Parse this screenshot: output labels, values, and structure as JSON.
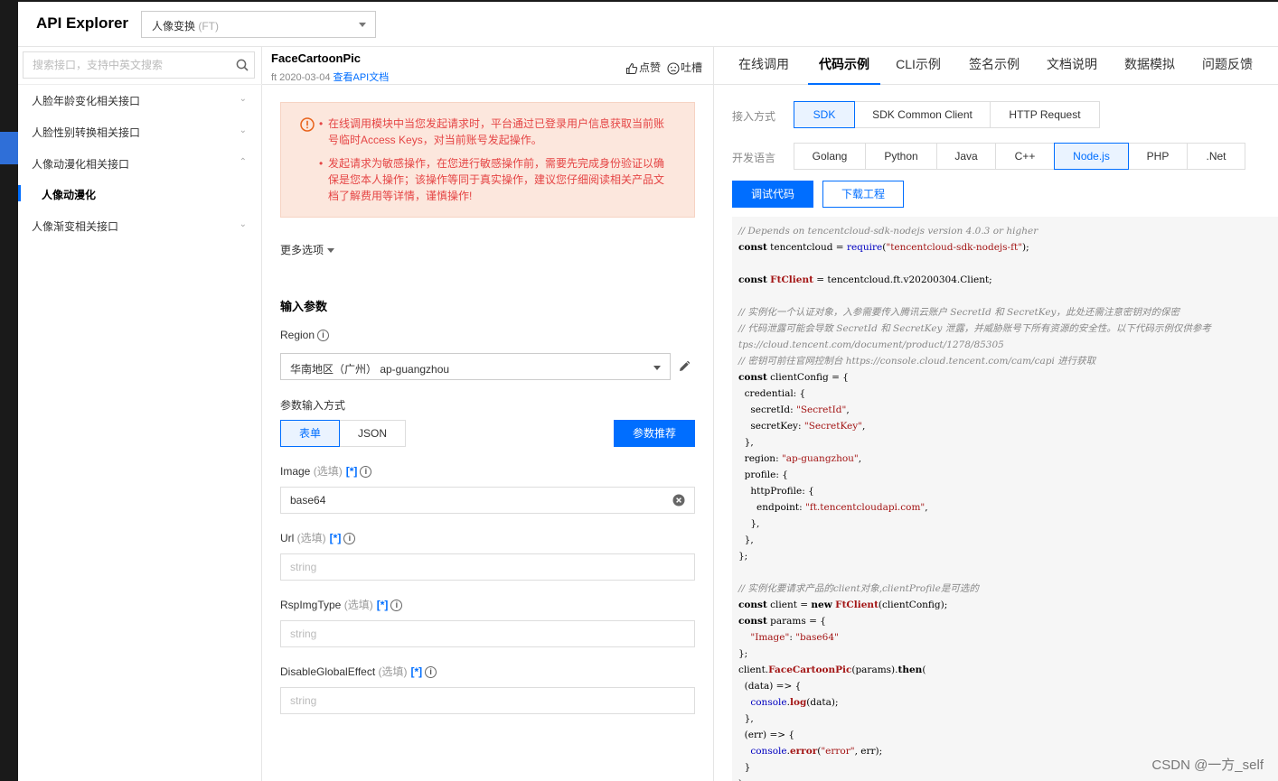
{
  "header": {
    "app_title": "API Explorer",
    "product": {
      "name": "人像变换",
      "code": "(FT)"
    }
  },
  "sidebar": {
    "search_placeholder": "搜索接口，支持中英文搜索",
    "items": [
      {
        "label": "人脸年龄变化相关接口",
        "chevron": "⌄"
      },
      {
        "label": "人脸性别转换相关接口",
        "chevron": "⌄"
      },
      {
        "label": "人像动漫化相关接口",
        "chevron": "⌃"
      },
      {
        "label": "人像动漫化"
      },
      {
        "label": "人像渐变相关接口",
        "chevron": "⌄"
      }
    ]
  },
  "api": {
    "name": "FaceCartoonPic",
    "meta": "ft 2020-03-04",
    "doc_link": "查看API文档",
    "like": "点赞",
    "comment": "吐槽"
  },
  "warning": {
    "line1": "在线调用模块中当您发起请求时，平台通过已登录用户信息获取当前账号临时Access Keys，对当前账号发起操作。",
    "line2": "发起请求为敏感操作，在您进行敏感操作前，需要先完成身份验证以确保是您本人操作；该操作等同于真实操作，建议您仔细阅读相关产品文档了解费用等详情，谨慎操作!"
  },
  "form": {
    "more_options": "更多选项",
    "input_params_title": "输入参数",
    "region_label": "Region",
    "region_value": "华南地区（广州） ap-guangzhou",
    "mode_label": "参数输入方式",
    "mode_table": "表单",
    "mode_json": "JSON",
    "param_recommend": "参数推荐",
    "optional": "(选填)",
    "bracket": "[*]",
    "fields": [
      {
        "name": "Image",
        "value": "base64",
        "placeholder": ""
      },
      {
        "name": "Url",
        "value": "",
        "placeholder": "string"
      },
      {
        "name": "RspImgType",
        "value": "",
        "placeholder": "string"
      },
      {
        "name": "DisableGlobalEffect",
        "value": "",
        "placeholder": "string"
      }
    ]
  },
  "right": {
    "tabs": [
      "在线调用",
      "代码示例",
      "CLI示例",
      "签名示例",
      "文档说明",
      "数据模拟",
      "问题反馈"
    ],
    "active_tab": "代码示例",
    "access_label": "接入方式",
    "access_options": [
      "SDK",
      "SDK Common Client",
      "HTTP Request"
    ],
    "access_active": "SDK",
    "lang_label": "开发语言",
    "languages": [
      "Golang",
      "Python",
      "Java",
      "C++",
      "Node.js",
      "PHP",
      ".Net"
    ],
    "lang_active": "Node.js",
    "debug_button": "调试代码",
    "download_button": "下载工程"
  },
  "code": {
    "l1": "// Depends on tencentcloud-sdk-nodejs version 4.0.3 or higher",
    "l2_kw": "const",
    "l2_a": " tencentcloud = ",
    "l2_req": "require",
    "l2_str": "\"tencentcloud-sdk-nodejs-ft\"",
    "l2_end": ");",
    "l4_kw": "const",
    "l4_fn": "FtClient",
    "l4_rest": " = tencentcloud.ft.v20200304.Client;",
    "l6": "// 实例化一个认证对象，入参需要传入腾讯云账户 SecretId 和 SecretKey，此处还需注意密钥对的保密",
    "l7": "// 代码泄露可能会导致 SecretId 和 SecretKey 泄露，并威胁账号下所有资源的安全性。以下代码示例仅供参考",
    "l8": "tps://cloud.tencent.com/document/product/1278/85305",
    "l9": "// 密钥可前往官网控制台 https://console.cloud.tencent.com/cam/capi 进行获取",
    "l10": "clientConfig = {",
    "l11": "  credential: {",
    "l12_a": "    secretId: ",
    "l12_s": "\"SecretId\"",
    "l13_a": "    secretKey: ",
    "l13_s": "\"SecretKey\"",
    "l14": "  },",
    "l15_a": "  region: ",
    "l15_s": "\"ap-guangzhou\"",
    "l16": "  profile: {",
    "l17": "    httpProfile: {",
    "l18_a": "      endpoint: ",
    "l18_s": "\"ft.tencentcloudapi.com\"",
    "l19": "    },",
    "l20": "  },",
    "l21": "};",
    "l23": "// 实例化要请求产品的client对象,clientProfile是可选的",
    "l24_kw1": "const",
    "l24_a": " client = ",
    "l24_kw2": "new",
    "l24_fn": "FtClient",
    "l24_b": "(clientConfig);",
    "l25_kw": "const",
    "l25_a": " params = {",
    "l26_k": "\"Image\"",
    "l26_v": "\"base64\"",
    "l27": "};",
    "l28_a": "client.",
    "l28_fn": "FaceCartoonPic",
    "l28_b": "(params).",
    "l28_then": "then",
    "l28_c": "(",
    "l29": "  (data) => {",
    "l30_obj": "console",
    "l30_fn": "log",
    "l30_b": "(data);",
    "l31": "  },",
    "l32": "  (err) => {",
    "l33_obj": "console",
    "l33_fn": "error",
    "l33_s": "\"error\"",
    "l33_b": ", err);",
    "l34": "  }",
    "l35": ");"
  },
  "watermark": "CSDN @一方_self"
}
